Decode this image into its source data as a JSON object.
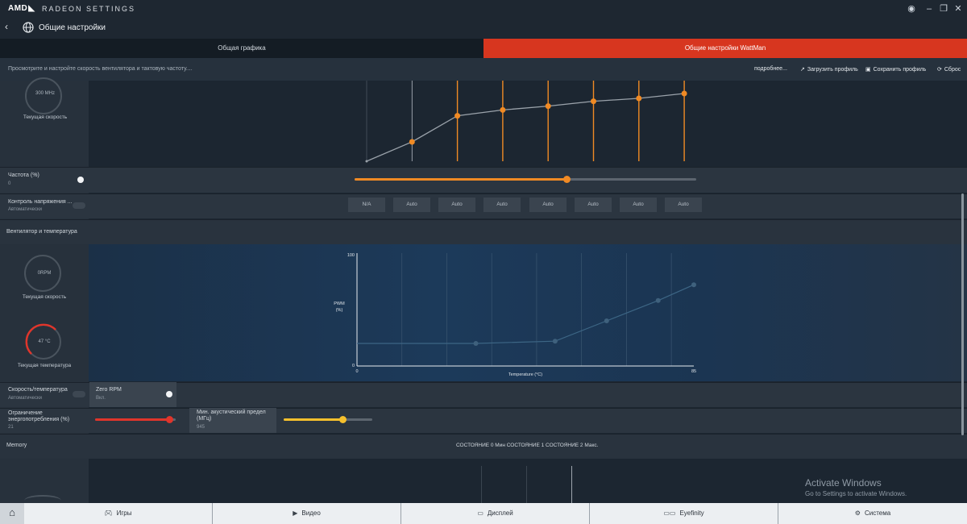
{
  "app": {
    "brand": "AMD",
    "title": "RADEON SETTINGS"
  },
  "header": {
    "page_title": "Общие настройки"
  },
  "tabs": [
    {
      "label": "Общая графика",
      "active": false
    },
    {
      "label": "Общие настройки WattMan",
      "active": true
    }
  ],
  "actionbar": {
    "description": "Просмотрите и настройте скорость вентилятора и тактовую частоту....",
    "more": "подробнее...",
    "load_profile": "Загрузить профиль",
    "save_profile": "Сохранить профиль",
    "reset": "Сброс"
  },
  "gpu": {
    "speed_value": "300 MHz",
    "speed_caption": "Текущая скорость",
    "chart_data": {
      "type": "line",
      "points": 8,
      "values": [
        0,
        20,
        47,
        53,
        57,
        62,
        65,
        70
      ],
      "ylim": [
        0,
        80
      ],
      "accent": "#f08a24"
    },
    "freq_label": "Частота (%)",
    "freq_value": "0",
    "freq_slider": 0.62,
    "voltage_label": "Контроль напряжения ...",
    "voltage_value": "Автоматически",
    "states": [
      "N/A",
      "Auto",
      "Auto",
      "Auto",
      "Auto",
      "Auto",
      "Auto",
      "Auto"
    ]
  },
  "fan": {
    "section_title": "Вентилятор и температура",
    "speed_value": "0RPM",
    "speed_caption": "Текущая скорость",
    "temp_value": "47 °C",
    "temp_caption": "Текущая температура",
    "chart_data": {
      "type": "line",
      "title": "",
      "xlabel": "Temperature (°C)",
      "ylabel": "PWM (%)",
      "xlim": [
        0,
        85
      ],
      "ylim": [
        0,
        100
      ],
      "x_ticks": [
        "0",
        "85"
      ],
      "y_ticks": [
        "0",
        "100"
      ],
      "points": [
        {
          "x": 0,
          "y": 20
        },
        {
          "x": 30,
          "y": 20
        },
        {
          "x": 50,
          "y": 22
        },
        {
          "x": 63,
          "y": 40
        },
        {
          "x": 76,
          "y": 58
        },
        {
          "x": 85,
          "y": 72
        }
      ]
    },
    "speed_temp_label": "Скорость/температура",
    "speed_temp_value": "Автоматически",
    "zero_rpm_label": "Zero RPM",
    "zero_rpm_value": "Вкл.",
    "power_limit_label": "Ограничение энергопотребления (%)",
    "power_limit_value": "21",
    "power_limit_slider": 0.92,
    "acoustic_label": "Мин. акустический предел (МГц)",
    "acoustic_value": "945",
    "acoustic_slider": 0.66
  },
  "memory": {
    "section_title": "Memory",
    "states_text": "СОСТОЯНИЕ 0 Мин  СОСТОЯНИЕ 1 СОСТОЯНИЕ 2 Макс."
  },
  "watermark": {
    "line1": "Activate Windows",
    "line2": "Go to Settings to activate Windows."
  },
  "bottomnav": [
    {
      "label": "Игры",
      "icon": "gamepad-icon"
    },
    {
      "label": "Видео",
      "icon": "play-icon"
    },
    {
      "label": "Дисплей",
      "icon": "monitor-icon"
    },
    {
      "label": "Eyefinity",
      "icon": "eyefinity-icon"
    },
    {
      "label": "Система",
      "icon": "system-icon"
    }
  ],
  "colors": {
    "accent_red": "#d7361f",
    "accent_orange": "#f08a24",
    "slider_red": "#e0352b",
    "slider_yellow": "#f5c02d"
  }
}
